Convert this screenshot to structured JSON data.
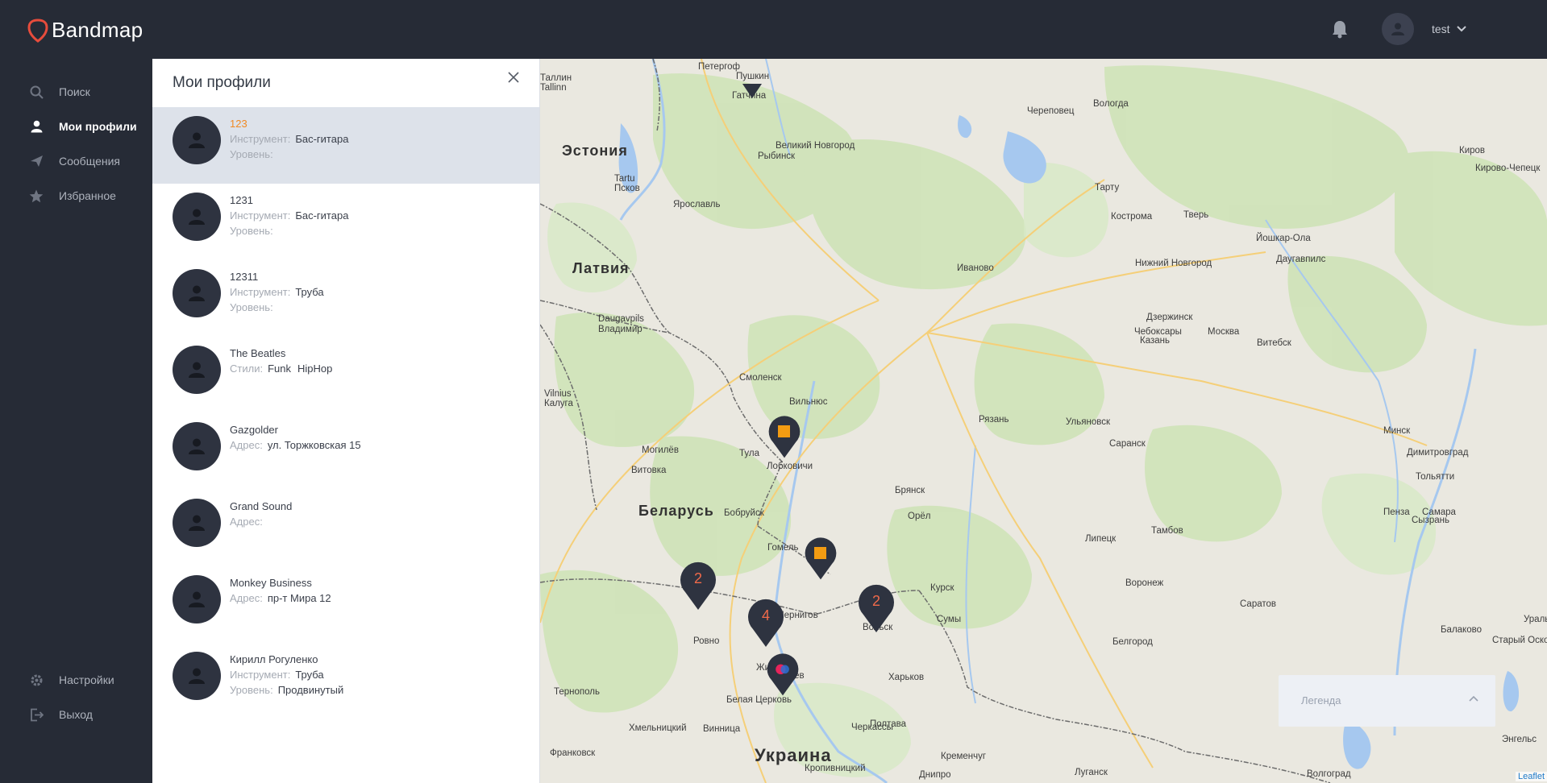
{
  "app": {
    "brand": "Bandmap",
    "user_name": "test"
  },
  "colors": {
    "accent": "#f08a24",
    "sidebar_bg": "#262b36",
    "pin": "#2e3340",
    "pin_number": "#f06a4a",
    "pin_square": "#f39c12"
  },
  "nav": {
    "items": [
      {
        "label": "Поиск",
        "icon": "search-icon"
      },
      {
        "label": "Мои профили",
        "icon": "user-icon",
        "active": true
      },
      {
        "label": "Сообщения",
        "icon": "paper-plane-icon"
      },
      {
        "label": "Избранное",
        "icon": "star-icon"
      }
    ],
    "bottom": [
      {
        "label": "Настройки",
        "icon": "gear-icon"
      },
      {
        "label": "Выход",
        "icon": "logout-icon"
      }
    ]
  },
  "panel": {
    "title": "Мои профили",
    "profiles": [
      {
        "name": "123",
        "lines": [
          {
            "k": "Инструмент:",
            "v": [
              "Бас-гитара"
            ]
          },
          {
            "k": "Уровень:",
            "v": []
          }
        ]
      },
      {
        "name": "1231",
        "lines": [
          {
            "k": "Инструмент:",
            "v": [
              "Бас-гитара"
            ]
          },
          {
            "k": "Уровень:",
            "v": []
          }
        ]
      },
      {
        "name": "12311",
        "lines": [
          {
            "k": "Инструмент:",
            "v": [
              "Труба"
            ]
          },
          {
            "k": "Уровень:",
            "v": []
          }
        ]
      },
      {
        "name": "The Beatles",
        "lines": [
          {
            "k": "Стили:",
            "v": [
              "Funk",
              "HipHop"
            ]
          }
        ]
      },
      {
        "name": "Gazgolder",
        "lines": [
          {
            "k": "Адрес:",
            "v": [
              "ул. Торжковская 15"
            ]
          }
        ]
      },
      {
        "name": "Grand Sound",
        "lines": [
          {
            "k": "Адрес:",
            "v": []
          }
        ]
      },
      {
        "name": "Monkey Business",
        "lines": [
          {
            "k": "Адрес:",
            "v": [
              "пр-т Мира 12"
            ]
          }
        ]
      },
      {
        "name": "Кирилл Рогуленко",
        "lines": [
          {
            "k": "Инструмент:",
            "v": [
              "Труба"
            ]
          },
          {
            "k": "Уровень:",
            "v": [
              "Продвинутый"
            ]
          }
        ]
      }
    ]
  },
  "map": {
    "countries": [
      "Эстония",
      "Латвия",
      "Беларусь",
      "Украина"
    ],
    "cities": [
      "Петергоф",
      "Пушкин",
      "Таллин",
      "Tallinn",
      "Гатчина",
      "Череповец",
      "Вологда",
      "Киров",
      "Кирово-Чепецк",
      "Великий Новгород",
      "Рыбинск",
      "Тарту",
      "Tartu",
      "Псков",
      "Ярославль",
      "Кострома",
      "Тверь",
      "Иваново",
      "Нижний Новгород",
      "Йошкар-Ола",
      "Даугавпилс",
      "Daugavpils",
      "Владимир",
      "Дзержинск",
      "Чебоксары",
      "Москва",
      "Казань",
      "Витебск",
      "Смоленск",
      "Вильнюс",
      "Vilnius",
      "Калуга",
      "Рязань",
      "Ульяновск",
      "Минск",
      "Могилёв",
      "Тула",
      "Саранск",
      "Димитровград",
      "Лобковичи",
      "Витовка",
      "Брянск",
      "Тольятти",
      "Бобруйск",
      "Орёл",
      "Пенза",
      "Сызрань",
      "Самара",
      "Гомель",
      "Липецк",
      "Тамбов",
      "Чернигов",
      "Курск",
      "Воронеж",
      "Саратов",
      "Вольск",
      "Балаково",
      "Старый Оскол",
      "Сумы",
      "Белгород",
      "Ровно",
      "Житомир",
      "Киев",
      "Харьков",
      "Белая Церковь",
      "Тернополь",
      "Полтава",
      "Хмельницкий",
      "Винница",
      "Черкассы",
      "Кременчуг",
      "Франковск",
      "Кропивницкий",
      "Днипро",
      "Луганск",
      "Волгоград",
      "Энгельс",
      "Уральск"
    ],
    "markers": [
      {
        "label": "2"
      },
      {
        "label": "4"
      },
      {
        "label": "2"
      }
    ],
    "legend_label": "Легенда",
    "attribution": "Leaflet"
  }
}
